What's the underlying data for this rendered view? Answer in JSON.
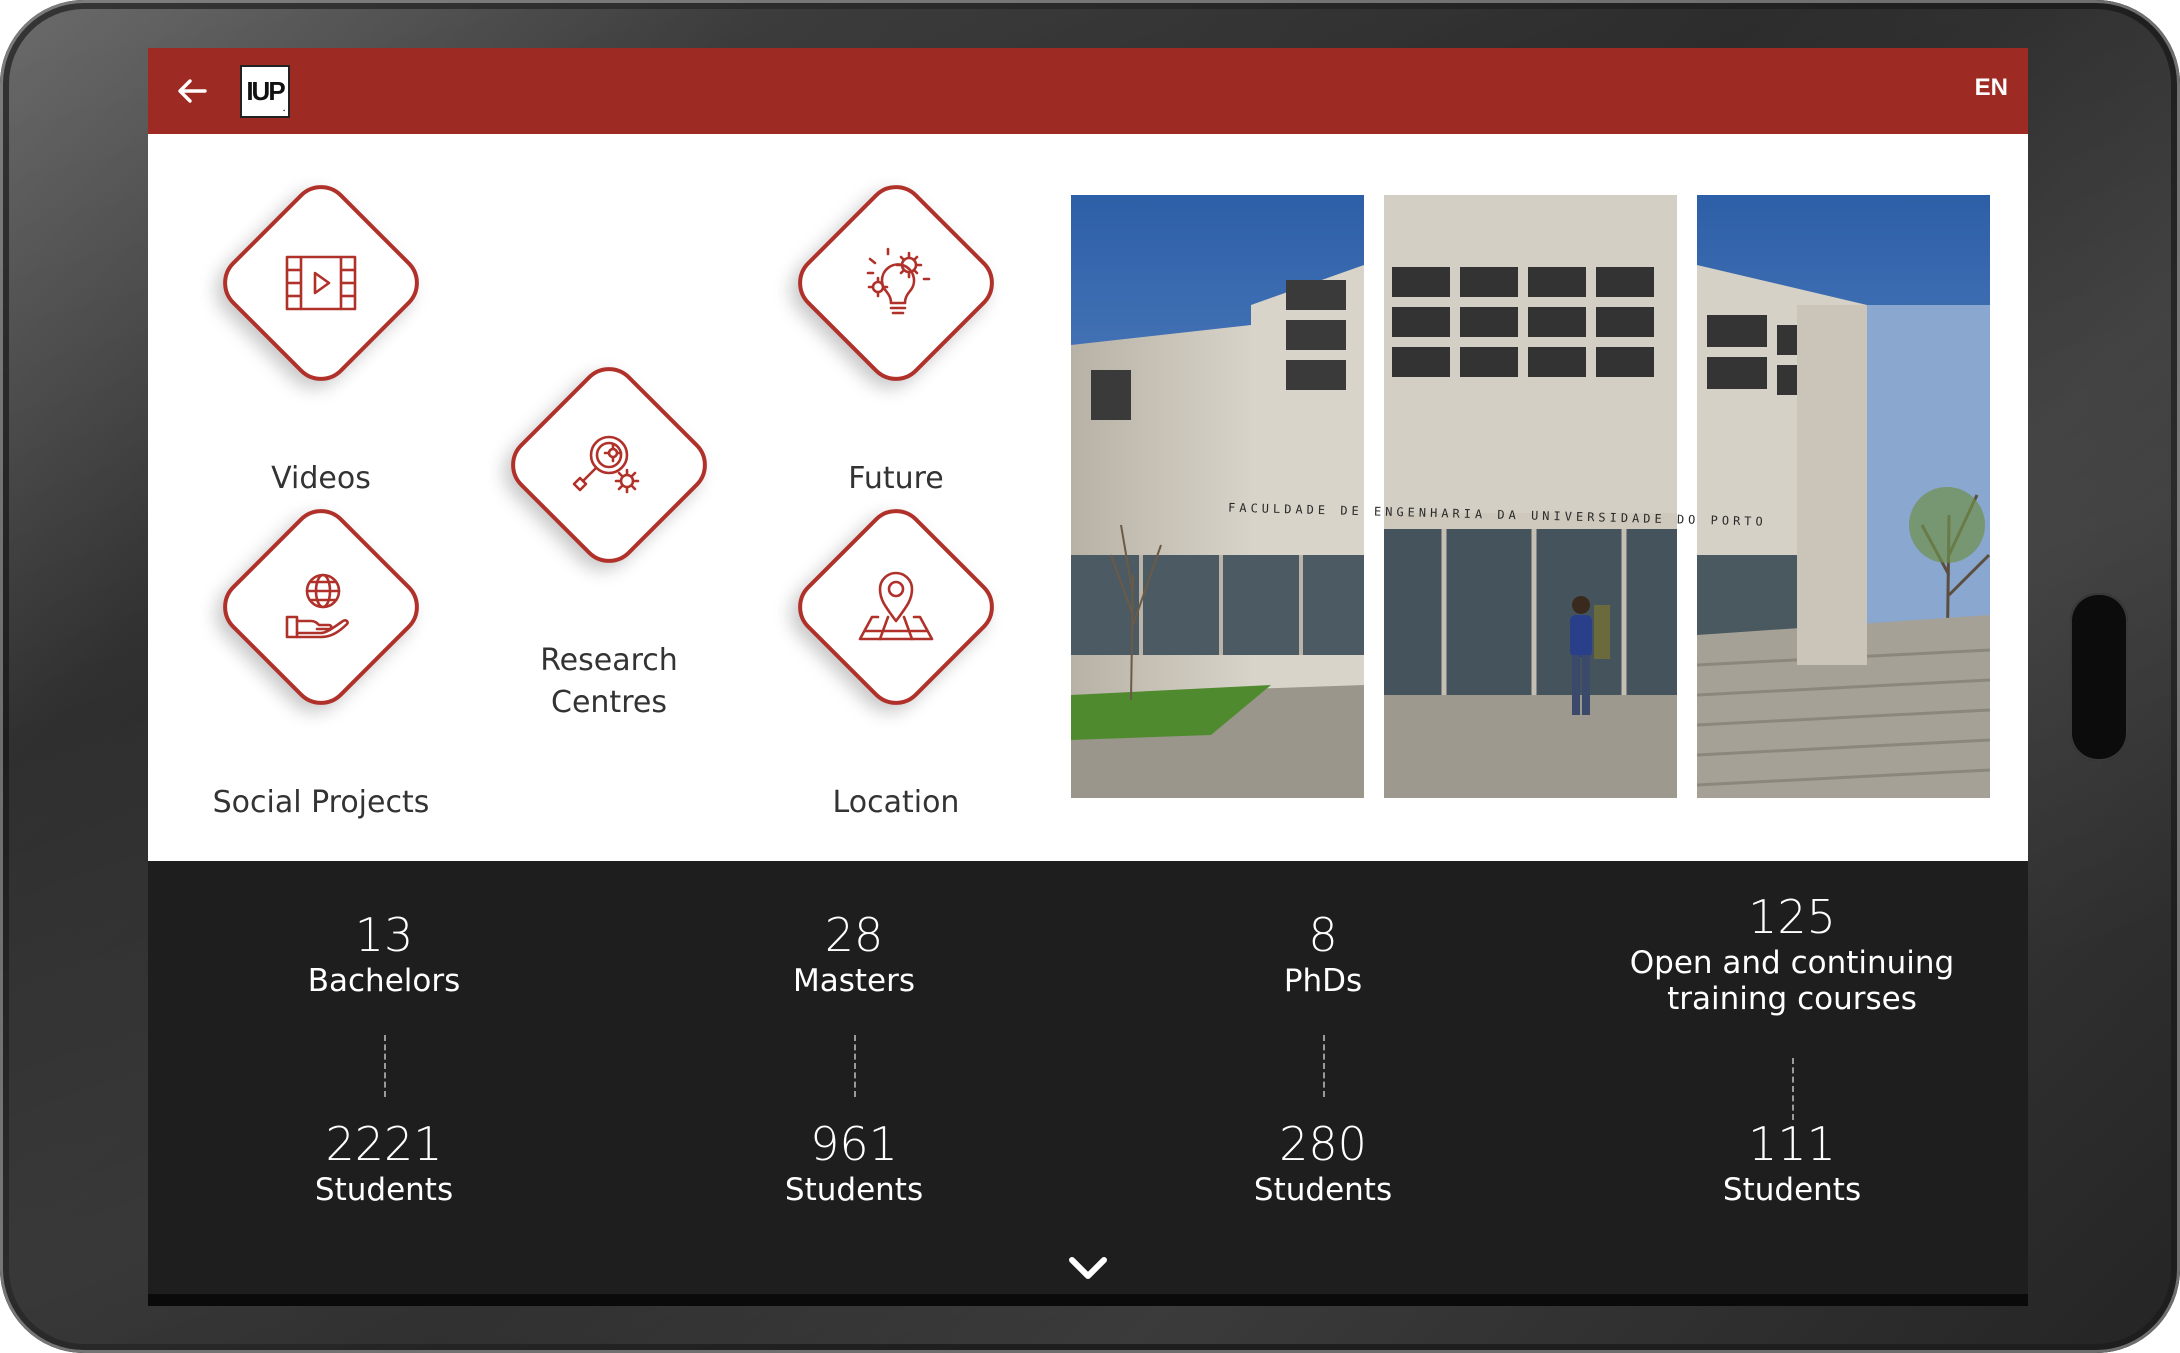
{
  "header": {
    "back_icon": "arrow-left-icon",
    "logo_text": "IUP",
    "lang": "EN",
    "bg_color": "#9e2b23"
  },
  "tiles": [
    {
      "label": "Videos",
      "icon": "film-icon"
    },
    {
      "label": "Future",
      "icon": "lightbulb-gears-icon"
    },
    {
      "label": "Research",
      "label2": "Centres",
      "icon": "magnifier-gears-icon"
    },
    {
      "label": "Social Projects",
      "icon": "globe-hand-icon"
    },
    {
      "label": "Location",
      "icon": "map-pin-icon"
    }
  ],
  "photo": {
    "sign_text": "FACULDADE DE ENGENHARIA DA UNIVERSIDADE DO PORTO"
  },
  "stats": [
    {
      "number": "13",
      "label": "Bachelors",
      "students": "2221",
      "students_label": "Students"
    },
    {
      "number": "28",
      "label": "Masters",
      "students": "961",
      "students_label": "Students"
    },
    {
      "number": "8",
      "label": "PhDs",
      "students": "280",
      "students_label": "Students"
    },
    {
      "number": "125",
      "label": "Open and continuing",
      "label2": "training courses",
      "students": "111",
      "students_label": "Students"
    }
  ],
  "colors": {
    "accent": "#b0312a",
    "stats_bg": "#1e1e1e"
  }
}
